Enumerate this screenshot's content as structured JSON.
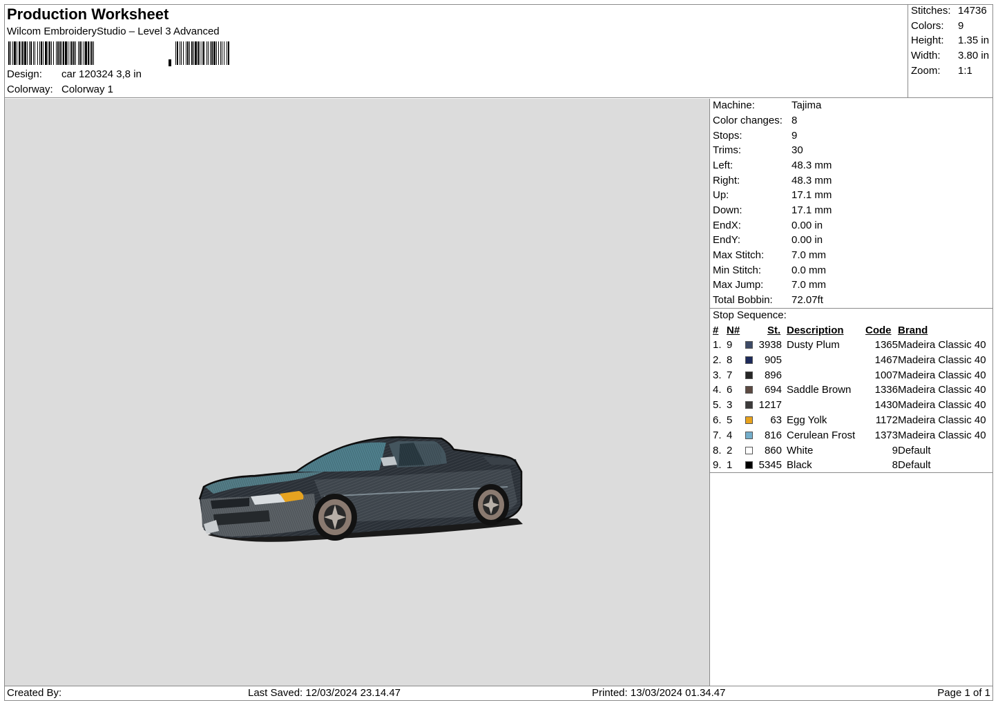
{
  "header": {
    "title": "Production Worksheet",
    "subtitle": "Wilcom EmbroideryStudio – Level 3 Advanced",
    "design_label": "Design:",
    "design_value": "car 120324 3,8 in",
    "colorway_label": "Colorway:",
    "colorway_value": "Colorway 1"
  },
  "summary": [
    {
      "label": "Stitches:",
      "value": "14736"
    },
    {
      "label": "Colors:",
      "value": "9"
    },
    {
      "label": "Height:",
      "value": "1.35 in"
    },
    {
      "label": "Width:",
      "value": "3.80 in"
    },
    {
      "label": "Zoom:",
      "value": "1:1"
    }
  ],
  "machine_info": [
    {
      "label": "Machine:",
      "value": "Tajima"
    },
    {
      "label": "Color changes:",
      "value": "8"
    },
    {
      "label": "Stops:",
      "value": "9"
    },
    {
      "label": "Trims:",
      "value": "30"
    },
    {
      "label": "Left:",
      "value": "48.3 mm"
    },
    {
      "label": "Right:",
      "value": "48.3 mm"
    },
    {
      "label": "Up:",
      "value": "17.1 mm"
    },
    {
      "label": "Down:",
      "value": "17.1 mm"
    },
    {
      "label": "EndX:",
      "value": "0.00 in"
    },
    {
      "label": "EndY:",
      "value": "0.00 in"
    },
    {
      "label": "Max Stitch:",
      "value": "7.0 mm"
    },
    {
      "label": "Min Stitch:",
      "value": "0.0 mm"
    },
    {
      "label": "Max Jump:",
      "value": "7.0 mm"
    },
    {
      "label": "Total Bobbin:",
      "value": "72.07ft"
    }
  ],
  "stop_sequence": {
    "title": "Stop Sequence:",
    "headers": {
      "index": "#",
      "needle": "N#",
      "stitch": "St.",
      "description": "Description",
      "code": "Code",
      "brand": "Brand"
    },
    "rows": [
      {
        "index": "1.",
        "needle": "9",
        "color": "#3d4a66",
        "stitches": "3938",
        "description": "Dusty Plum",
        "code": "1365",
        "brand": "Madeira Classic 40"
      },
      {
        "index": "2.",
        "needle": "8",
        "color": "#1d2a5a",
        "stitches": "905",
        "description": "",
        "code": "1467",
        "brand": "Madeira Classic 40"
      },
      {
        "index": "3.",
        "needle": "7",
        "color": "#262626",
        "stitches": "896",
        "description": "",
        "code": "1007",
        "brand": "Madeira Classic 40"
      },
      {
        "index": "4.",
        "needle": "6",
        "color": "#5c4a42",
        "stitches": "694",
        "description": "Saddle Brown",
        "code": "1336",
        "brand": "Madeira Classic 40"
      },
      {
        "index": "5.",
        "needle": "3",
        "color": "#3d3b3b",
        "stitches": "1217",
        "description": "",
        "code": "1430",
        "brand": "Madeira Classic 40"
      },
      {
        "index": "6.",
        "needle": "5",
        "color": "#e8a21c",
        "stitches": "63",
        "description": "Egg Yolk",
        "code": "1172",
        "brand": "Madeira Classic 40"
      },
      {
        "index": "7.",
        "needle": "4",
        "color": "#74aecb",
        "stitches": "816",
        "description": "Cerulean Frost",
        "code": "1373",
        "brand": "Madeira Classic 40"
      },
      {
        "index": "8.",
        "needle": "2",
        "color": "#ffffff",
        "stitches": "860",
        "description": "White",
        "code": "9",
        "brand": "Default"
      },
      {
        "index": "9.",
        "needle": "1",
        "color": "#000000",
        "stitches": "5345",
        "description": "Black",
        "code": "8",
        "brand": "Default"
      }
    ]
  },
  "footer": {
    "created_by": "Created By:",
    "last_saved": "Last Saved: 12/03/2024 23.14.47",
    "printed": "Printed: 13/03/2024 01.34.47",
    "page": "Page 1 of 1"
  }
}
